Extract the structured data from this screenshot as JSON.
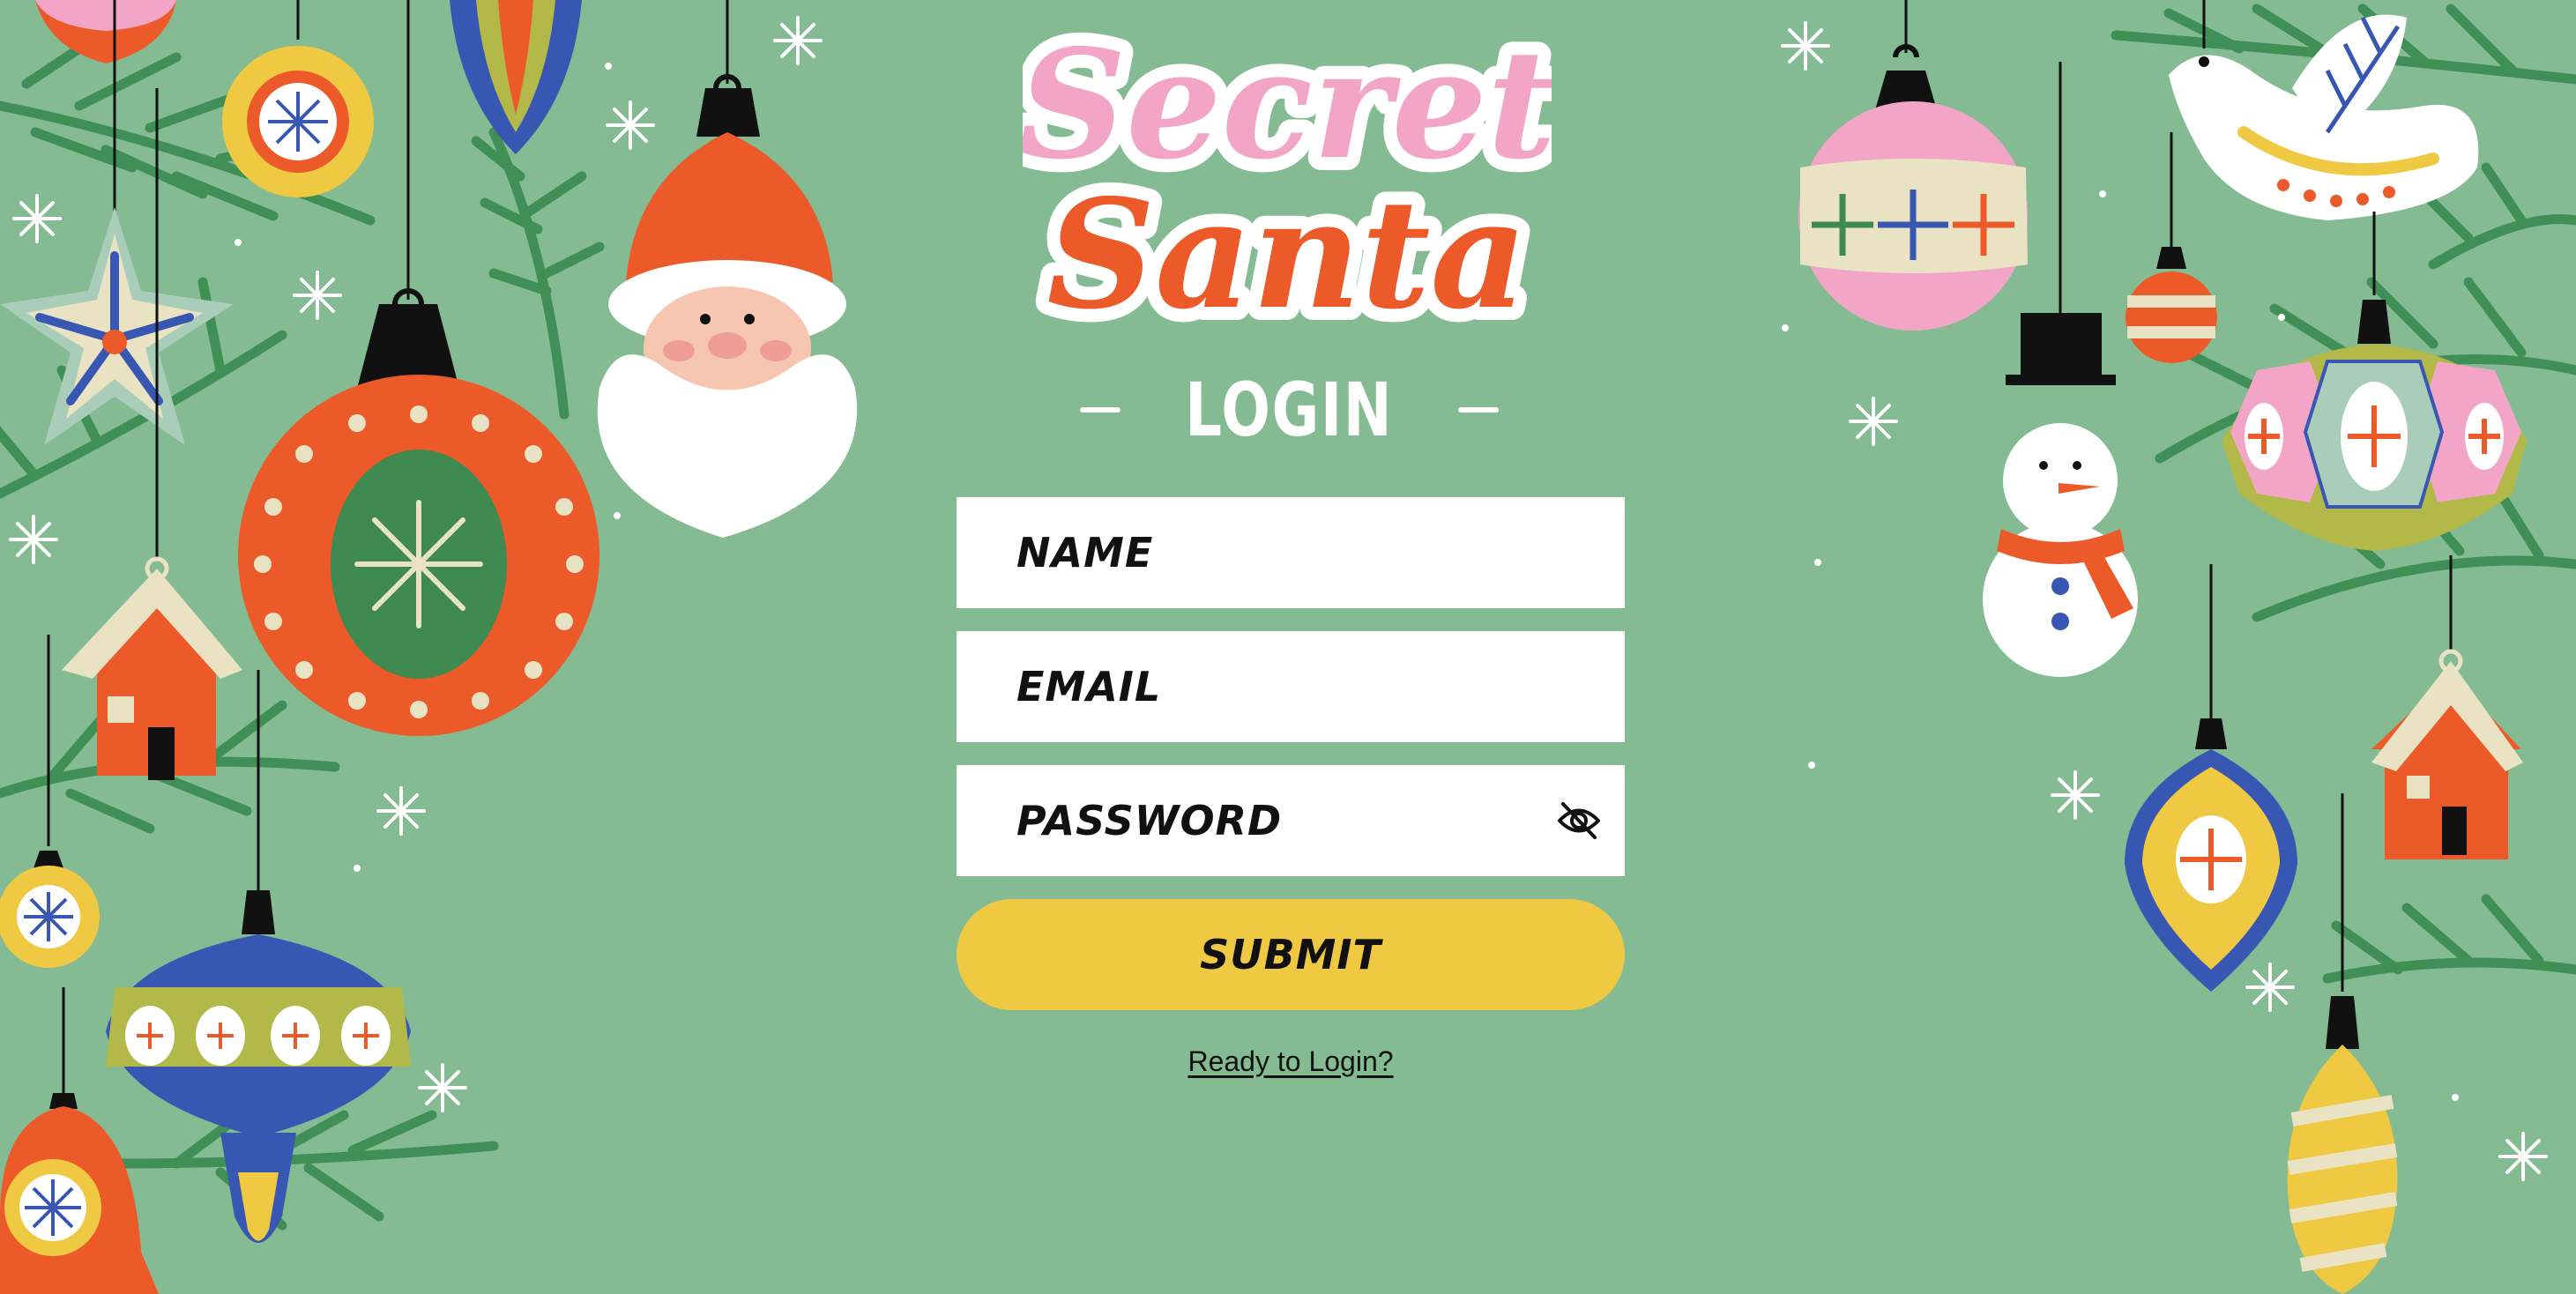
{
  "app": {
    "title_line1": "Secret",
    "title_line2": "Santa",
    "heading": "LOGIN"
  },
  "form": {
    "name": {
      "placeholder": "NAME",
      "value": ""
    },
    "email": {
      "placeholder": "EMAIL",
      "value": ""
    },
    "password": {
      "placeholder": "PASSWORD",
      "value": "",
      "visibility_icon": "eye-off-icon"
    },
    "submit_label": "SUBMIT",
    "footer_link": "Ready to Login?"
  },
  "colors": {
    "background": "#84bb92",
    "title_pink": "#f2a5c6",
    "title_orange": "#ec5a2a",
    "submit_yellow": "#f0c943",
    "field_bg": "#ffffff"
  },
  "decorations": [
    "santa-ornament",
    "snowman-ornament",
    "dove-ornament",
    "house-ornament",
    "star-ornament",
    "bauble-ornament",
    "bell-ornament",
    "snowflake-icon",
    "pine-branches"
  ]
}
